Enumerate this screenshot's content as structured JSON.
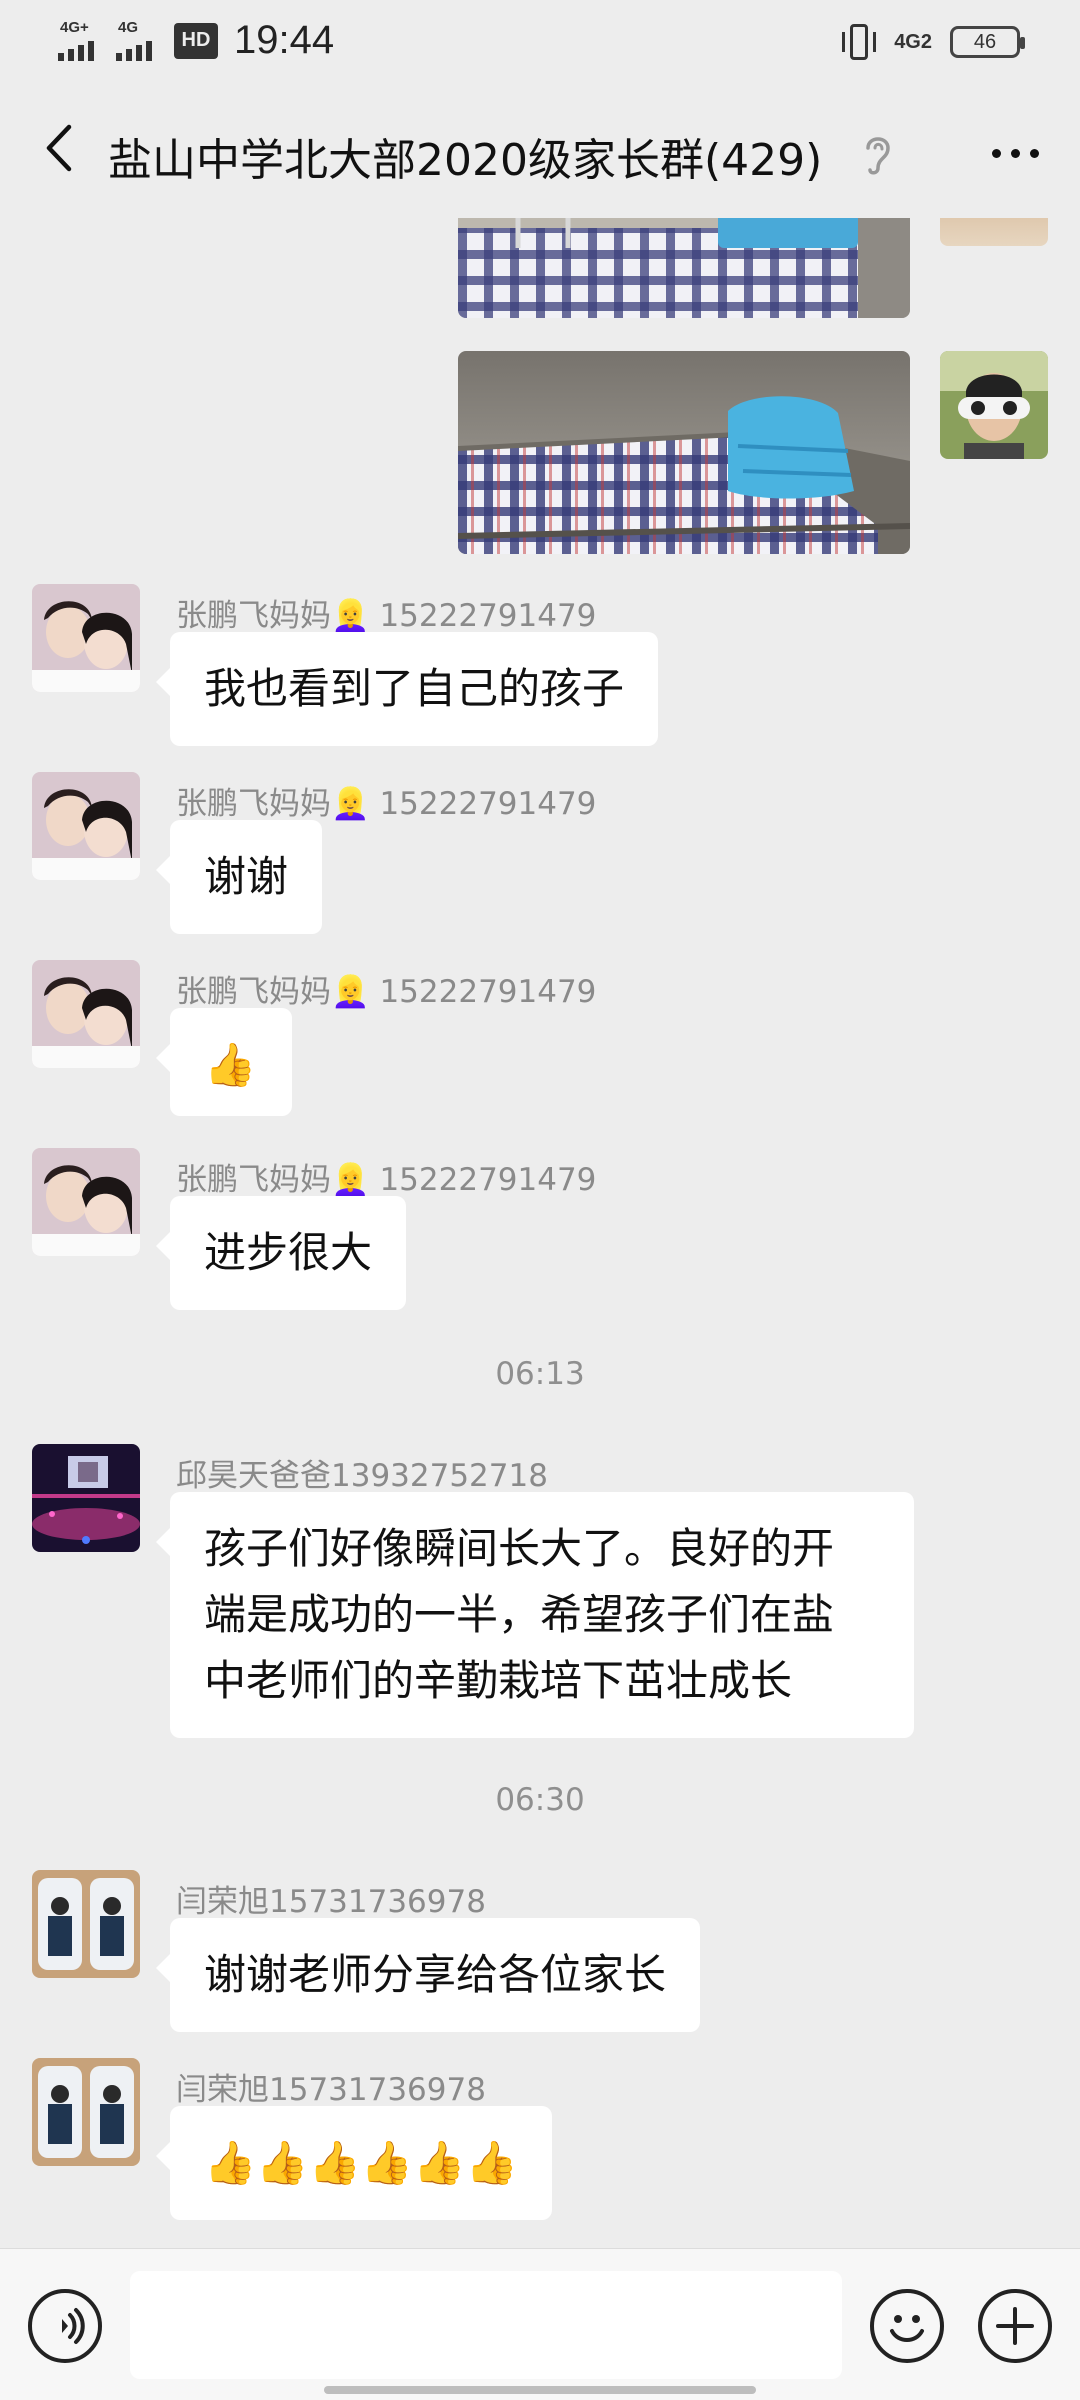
{
  "status_bar": {
    "time": "19:44",
    "sim1_label": "4G+",
    "sim2_label": "4G",
    "hd_label": "HD",
    "network_right": "4G2",
    "battery": "46"
  },
  "header": {
    "title": "盐山中学北大部2020级家长群(429)",
    "icons": [
      "back-arrow-icon",
      "ear-mute-icon",
      "more-dots-icon"
    ]
  },
  "messages": [
    {
      "type": "photo",
      "side": "right",
      "subject": "dorm bed checkered sheet (partially visible)"
    },
    {
      "type": "photo",
      "side": "right",
      "subject": "dorm bed with blue folded quilt"
    },
    {
      "sender": "张鹏飞妈妈👱‍♀️ 15222791479",
      "text": "我也看到了自己的孩子"
    },
    {
      "sender": "张鹏飞妈妈👱‍♀️ 15222791479",
      "text": "谢谢"
    },
    {
      "sender": "张鹏飞妈妈👱‍♀️ 15222791479",
      "text": "👍"
    },
    {
      "sender": "张鹏飞妈妈👱‍♀️ 15222791479",
      "text": "进步很大"
    },
    {
      "timestamp": "06:13"
    },
    {
      "sender": "邱昊天爸爸13932752718",
      "lines": [
        "孩子们好像瞬间长大了。良好的开",
        "端是成功的一半，希望孩子们在盐",
        "中老师们的辛勤栽培下茁壮成长"
      ]
    },
    {
      "timestamp": "06:30"
    },
    {
      "sender": "闫荣旭15731736978",
      "text": "谢谢老师分享给各位家长"
    },
    {
      "sender": "闫荣旭15731736978",
      "text": "👍👍👍👍👍👍"
    }
  ],
  "input_bar": {
    "placeholder": "",
    "icons": [
      "voice-icon",
      "emoji-icon",
      "plus-icon"
    ]
  },
  "colors": {
    "background": "#ededed",
    "bubble": "#ffffff",
    "meta_text": "#8a8a8a"
  }
}
